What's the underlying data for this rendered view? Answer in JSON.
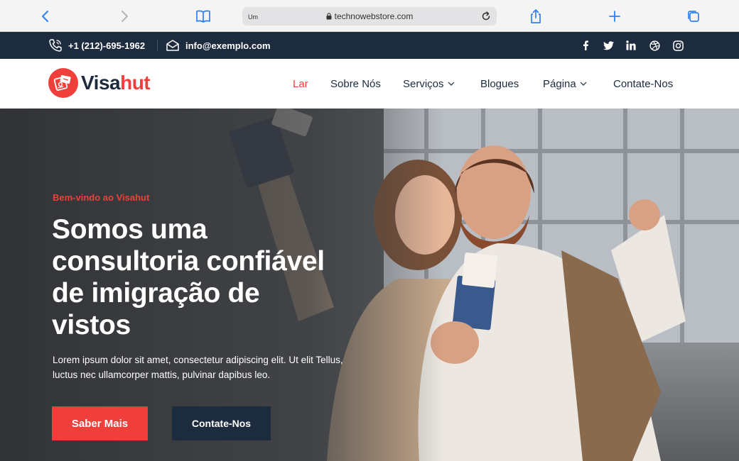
{
  "browser": {
    "tab_text": "Um",
    "url": "technowebstore.com",
    "icons": [
      "back-icon",
      "forward-icon",
      "bookmarks-icon",
      "lock-icon",
      "reload-icon",
      "share-icon",
      "new-tab-icon",
      "tabs-icon"
    ]
  },
  "topbar": {
    "phone": "+1 (212)-695-1962",
    "email": "info@exemplo.com",
    "social": [
      "facebook-icon",
      "twitter-icon",
      "linkedin-icon",
      "dribbble-icon",
      "instagram-icon"
    ]
  },
  "brand": {
    "name_part1": "Visa",
    "name_part2": "hut",
    "accent_color": "#f03f3a",
    "navy_color": "#1d2b3e"
  },
  "nav": {
    "items": [
      {
        "label": "Lar",
        "active": true
      },
      {
        "label": "Sobre Nós"
      },
      {
        "label": "Serviços",
        "dropdown": true
      },
      {
        "label": "Blogues"
      },
      {
        "label": "Página",
        "dropdown": true
      },
      {
        "label": "Contate-Nos"
      }
    ]
  },
  "hero": {
    "kicker": "Bem-vindo ao Visahut",
    "title_lines": [
      "Somos uma",
      "consultoria confiável",
      "de imigração de",
      "vistos"
    ],
    "lead": "Lorem ipsum dolor sit amet, consectetur adipiscing elit. Ut elit Tellus, luctus nec ullamcorper mattis, pulvinar dapibus leo.",
    "primary_button": "Saber Mais",
    "secondary_button": "Contate-Nos"
  }
}
